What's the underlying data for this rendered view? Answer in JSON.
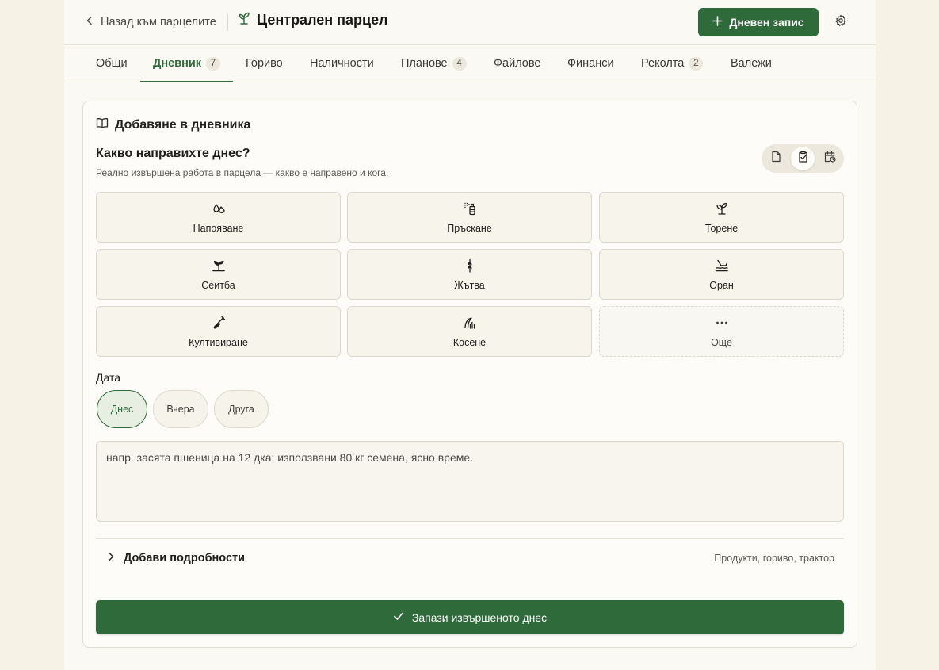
{
  "header": {
    "back_label": "Назад към парцелите",
    "title": "Централен парцел",
    "primary_button": "Дневен запис"
  },
  "tabs": [
    {
      "label": "Общи",
      "count": null
    },
    {
      "label": "Дневник",
      "count": "7",
      "active": true
    },
    {
      "label": "Гориво",
      "count": null
    },
    {
      "label": "Наличности",
      "count": null
    },
    {
      "label": "Планове",
      "count": "4"
    },
    {
      "label": "Файлове",
      "count": null
    },
    {
      "label": "Финанси",
      "count": null
    },
    {
      "label": "Реколта",
      "count": "2"
    },
    {
      "label": "Валежи",
      "count": null
    }
  ],
  "card": {
    "title": "Добавяне в дневника",
    "question": "Какво направихте днес?",
    "subtitle": "Реално извършена работа в парцела — какво е направено и кога.",
    "modes": [
      {
        "icon": "file-icon",
        "selected": false
      },
      {
        "icon": "clipboard-check-icon",
        "selected": true
      },
      {
        "icon": "calendar-clock-icon",
        "selected": false
      }
    ],
    "activities": [
      {
        "label": "Напояване",
        "icon": "droplets-icon"
      },
      {
        "label": "Пръскане",
        "icon": "spray-can-icon"
      },
      {
        "label": "Торене",
        "icon": "sprout-icon"
      },
      {
        "label": "Сеитба",
        "icon": "seedling-icon"
      },
      {
        "label": "Жътва",
        "icon": "wheat-icon"
      },
      {
        "label": "Оран",
        "icon": "plough-icon"
      },
      {
        "label": "Култивиране",
        "icon": "shovel-icon"
      },
      {
        "label": "Косене",
        "icon": "grass-icon"
      },
      {
        "label": "Още",
        "icon": "more-icon"
      }
    ],
    "date_label": "Дата",
    "date_options": [
      {
        "label": "Днес",
        "selected": true
      },
      {
        "label": "Вчера",
        "selected": false
      },
      {
        "label": "Друга",
        "selected": false
      }
    ],
    "notes_placeholder": "напр. засята пшеница на 12 дка; използвани 80 кг семена, ясно време.",
    "details_title": "Добави подробности",
    "details_hint": "Продукти, гориво, трактор",
    "save_label": "Запази извършеното днес"
  },
  "colors": {
    "accent": "#2f6a3b",
    "background": "#f6f2e6",
    "surface": "#fdfcf8"
  }
}
